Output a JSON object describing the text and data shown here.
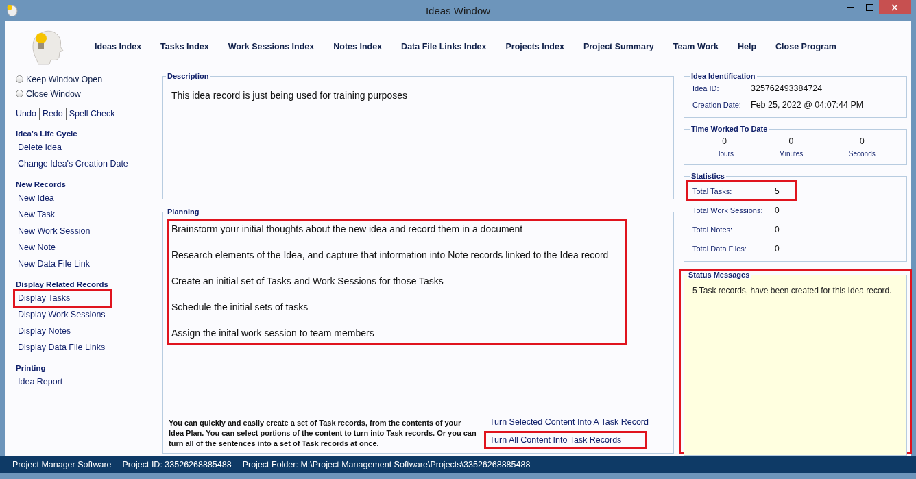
{
  "window": {
    "title": "Ideas Window"
  },
  "menu": [
    {
      "label": "Ideas Index"
    },
    {
      "label": "Tasks Index"
    },
    {
      "label": "Work Sessions Index"
    },
    {
      "label": "Notes Index"
    },
    {
      "label": "Data File Links Index"
    },
    {
      "label": "Projects Index"
    },
    {
      "label": "Project Summary"
    },
    {
      "label": "Team Work"
    },
    {
      "label": "Help"
    },
    {
      "label": "Close Program"
    }
  ],
  "window_options": [
    {
      "label": "Keep Window Open",
      "selected": false
    },
    {
      "label": "Close Window",
      "selected": false
    }
  ],
  "edit_links": [
    "Undo",
    "Redo",
    "Spell Check"
  ],
  "sidebar_sections": [
    {
      "heading": "Idea's Life Cycle",
      "items": [
        {
          "label": "Delete Idea",
          "highlighted": false
        },
        {
          "label": "Change Idea's Creation Date",
          "highlighted": false
        }
      ]
    },
    {
      "heading": "New Records",
      "items": [
        {
          "label": "New Idea",
          "highlighted": false
        },
        {
          "label": "New Task",
          "highlighted": false
        },
        {
          "label": "New Work Session",
          "highlighted": false
        },
        {
          "label": "New Note",
          "highlighted": false
        },
        {
          "label": "New Data File Link",
          "highlighted": false
        }
      ]
    },
    {
      "heading": "Display Related Records",
      "items": [
        {
          "label": "Display Tasks",
          "highlighted": true
        },
        {
          "label": "Display Work Sessions",
          "highlighted": false
        },
        {
          "label": "Display Notes",
          "highlighted": false
        },
        {
          "label": "Display Data File Links",
          "highlighted": false
        }
      ]
    },
    {
      "heading": "Printing",
      "items": [
        {
          "label": "Idea Report",
          "highlighted": false
        }
      ]
    }
  ],
  "description": {
    "legend": "Description",
    "text": "This idea record is just being used for training purposes"
  },
  "planning": {
    "legend": "Planning",
    "highlighted": true,
    "lines": [
      "Brainstorm your initial thoughts about the new idea and record them in a document",
      "Research elements of the Idea, and capture that information into Note records linked to the Idea record",
      "Create an initial set of Tasks and Work Sessions for those Tasks",
      "Schedule the initial sets of tasks",
      "Assign the inital work session to team members"
    ],
    "help_text": "You can quickly and easily create a set of Task records, from the contents of your Idea Plan. You can select portions of the content to turn into Task records. Or you can turn all of the sentences into a set of Task records at once.",
    "actions": [
      {
        "label": "Turn Selected Content Into A Task Record",
        "highlighted": false
      },
      {
        "label": "Turn All Content Into Task Records",
        "highlighted": true
      }
    ]
  },
  "idea_identification": {
    "legend": "Idea Identification",
    "fields": [
      {
        "label": "Idea ID:",
        "value": "325762493384724"
      },
      {
        "label": "Creation Date:",
        "value": "Feb  25, 2022 @ 04:07:44 PM"
      }
    ]
  },
  "time_worked": {
    "legend": "Time Worked To Date",
    "units": [
      {
        "value": "0",
        "label": "Hours"
      },
      {
        "value": "0",
        "label": "Minutes"
      },
      {
        "value": "0",
        "label": "Seconds"
      }
    ]
  },
  "statistics": {
    "legend": "Statistics",
    "rows": [
      {
        "label": "Total Tasks:",
        "value": "5",
        "highlighted": true
      },
      {
        "label": "Total Work Sessions:",
        "value": "0",
        "highlighted": false
      },
      {
        "label": "Total Notes:",
        "value": "0",
        "highlighted": false
      },
      {
        "label": "Total Data Files:",
        "value": "0",
        "highlighted": false
      }
    ]
  },
  "status_messages": {
    "legend": "Status Messages",
    "message": "5 Task records, have been created for this Idea record.",
    "highlighted": true
  },
  "status_bar": [
    "Project Manager Software",
    "Project ID:  33526268885488",
    "Project Folder: M:\\Project Management Software\\Projects\\33526268885488"
  ]
}
